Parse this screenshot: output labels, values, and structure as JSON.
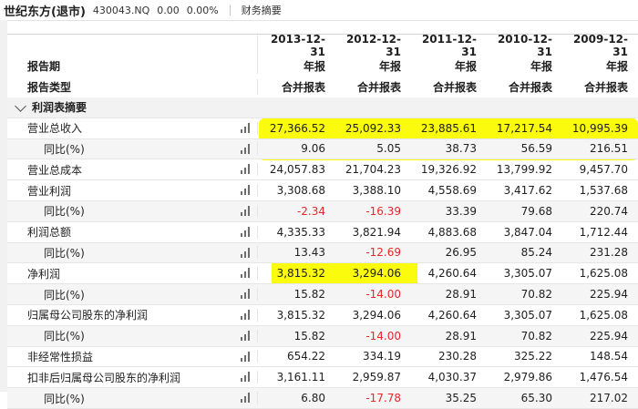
{
  "header": {
    "name": "世纪东方(退市)",
    "code": "430043.NQ",
    "price": "0.00",
    "change_pct": "0.00%",
    "tab": "财务摘要"
  },
  "columns": [
    "2013-12-31",
    "2012-12-31",
    "2011-12-31",
    "2010-12-31",
    "2009-12-31"
  ],
  "period_row": {
    "label": "报告期",
    "values": [
      "年报",
      "年报",
      "年报",
      "年报",
      "年报"
    ]
  },
  "type_row": {
    "label": "报告类型",
    "values": [
      "合并报表",
      "合并报表",
      "合并报表",
      "合并报表",
      "合并报表"
    ]
  },
  "section": "利润表摘要",
  "rows": [
    {
      "label": "营业总收入",
      "values": [
        "27,366.52",
        "25,092.33",
        "23,885.61",
        "17,217.54",
        "10,995.39"
      ]
    },
    {
      "label": "同比(%)",
      "values": [
        "9.06",
        "5.05",
        "38.73",
        "56.59",
        "216.51"
      ]
    },
    {
      "label": "营业总成本",
      "values": [
        "24,057.83",
        "21,704.23",
        "19,326.92",
        "13,799.92",
        "9,457.70"
      ]
    },
    {
      "label": "营业利润",
      "values": [
        "3,308.68",
        "3,388.10",
        "4,558.69",
        "3,417.62",
        "1,537.68"
      ]
    },
    {
      "label": "同比(%)",
      "values": [
        "-2.34",
        "-16.39",
        "33.39",
        "79.68",
        "220.74"
      ]
    },
    {
      "label": "利润总额",
      "values": [
        "4,335.33",
        "3,821.94",
        "4,883.68",
        "3,847.04",
        "1,712.44"
      ]
    },
    {
      "label": "同比(%)",
      "values": [
        "13.43",
        "-12.69",
        "26.95",
        "85.24",
        "231.28"
      ]
    },
    {
      "label": "净利润",
      "values": [
        "3,815.32",
        "3,294.06",
        "4,260.64",
        "3,305.07",
        "1,625.08"
      ]
    },
    {
      "label": "同比(%)",
      "values": [
        "15.82",
        "-14.00",
        "28.91",
        "70.82",
        "225.94"
      ]
    },
    {
      "label": "归属母公司股东的净利润",
      "values": [
        "3,815.32",
        "3,294.06",
        "4,260.64",
        "3,305.07",
        "1,625.08"
      ]
    },
    {
      "label": "同比(%)",
      "values": [
        "15.82",
        "-14.00",
        "28.91",
        "70.82",
        "225.94"
      ]
    },
    {
      "label": "非经常性损益",
      "values": [
        "654.22",
        "334.19",
        "230.28",
        "325.22",
        "148.54"
      ]
    },
    {
      "label": "扣非后归属母公司股东的净利润",
      "values": [
        "3,161.11",
        "2,959.87",
        "4,030.37",
        "2,979.86",
        "1,476.54"
      ]
    },
    {
      "label": "同比(%)",
      "values": [
        "6.80",
        "-17.78",
        "35.25",
        "65.30",
        "217.02"
      ]
    }
  ],
  "icons": {
    "row_chart": "bar-chart-icon",
    "section_toggle": "chevron-down-icon"
  },
  "colors": {
    "highlight": "#fbfb00",
    "negative": "#e5272a"
  }
}
